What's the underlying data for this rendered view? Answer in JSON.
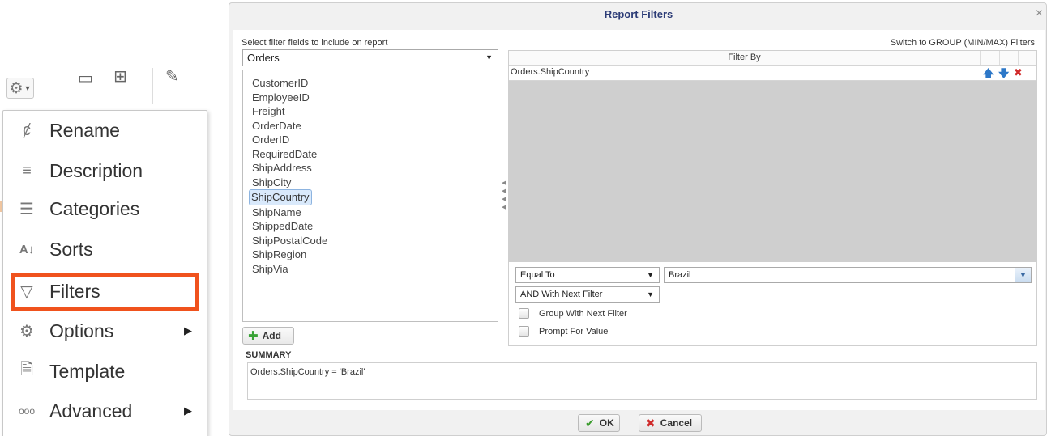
{
  "menu": {
    "items": [
      {
        "label": "Rename",
        "icon": "rename-icon",
        "glyph": "ȼ",
        "submenu": false
      },
      {
        "label": "Description",
        "icon": "description-icon",
        "glyph": "≡",
        "submenu": false
      },
      {
        "label": "Categories",
        "icon": "categories-icon",
        "glyph": "☰",
        "submenu": false
      },
      {
        "label": "Sorts",
        "icon": "sort-az-icon",
        "glyph": "A↓",
        "submenu": false
      },
      {
        "label": "Filters",
        "icon": "filter-icon",
        "glyph": "▽",
        "submenu": false,
        "highlighted": true
      },
      {
        "label": "Options",
        "icon": "gear-icon",
        "glyph": "⚙",
        "submenu": true
      },
      {
        "label": "Template",
        "icon": "template-icon",
        "glyph": "🗎",
        "submenu": false
      },
      {
        "label": "Advanced",
        "icon": "ellipsis-icon",
        "glyph": "ooo",
        "submenu": true
      }
    ],
    "highlight_color": "#f0521d"
  },
  "dialog": {
    "title": "Report Filters",
    "close_glyph": "×",
    "select_fields_label": "Select filter fields to include on report",
    "switch_link": "Switch to GROUP (MIN/MAX) Filters",
    "table_select": "Orders",
    "fields": [
      "CustomerID",
      "EmployeeID",
      "Freight",
      "OrderDate",
      "OrderID",
      "RequiredDate",
      "ShipAddress",
      "ShipCity",
      "ShipCountry",
      "ShipName",
      "ShippedDate",
      "ShipPostalCode",
      "ShipRegion",
      "ShipVia"
    ],
    "selected_field": "ShipCountry",
    "add_label": "Add",
    "filter_header": "Filter By",
    "filter_row": "Orders.ShipCountry",
    "operator": "Equal To",
    "value": "Brazil",
    "join": "AND With Next Filter",
    "group_with_next": "Group With Next Filter",
    "prompt_for_value": "Prompt For Value",
    "summary_label": "SUMMARY",
    "summary_text": "Orders.ShipCountry = 'Brazil'",
    "ok_label": "OK",
    "cancel_label": "Cancel",
    "title_color": "#2c3c77"
  }
}
